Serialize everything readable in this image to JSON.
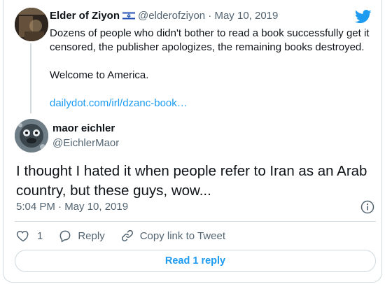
{
  "parent_tweet": {
    "author_name": "Elder of Ziyon",
    "flag_icon": "israel-flag-icon",
    "handle": "@elderofziyon",
    "date": "May 10, 2019",
    "separator": "·",
    "text_line1": "Dozens of people who didn't bother to read a book successfully get it censored, the publisher apologizes, the remaining books destroyed.",
    "text_line2": "Welcome to America.",
    "link": "dailydot.com/irl/dzanc-book…"
  },
  "reply_tweet": {
    "author_name": "maor eichler",
    "handle": "@EichlerMaor",
    "text": "I thought I hated it when people refer to Iran as an Arab country, but these guys, wow...",
    "timestamp": "5:04 PM · May 10, 2019"
  },
  "actions": {
    "like_count": "1",
    "reply_label": "Reply",
    "copy_link_label": "Copy link to Tweet"
  },
  "read_replies_label": "Read 1 reply",
  "colors": {
    "accent": "#1d9bf0",
    "secondary_text": "#536471",
    "border": "#cfd9de"
  }
}
